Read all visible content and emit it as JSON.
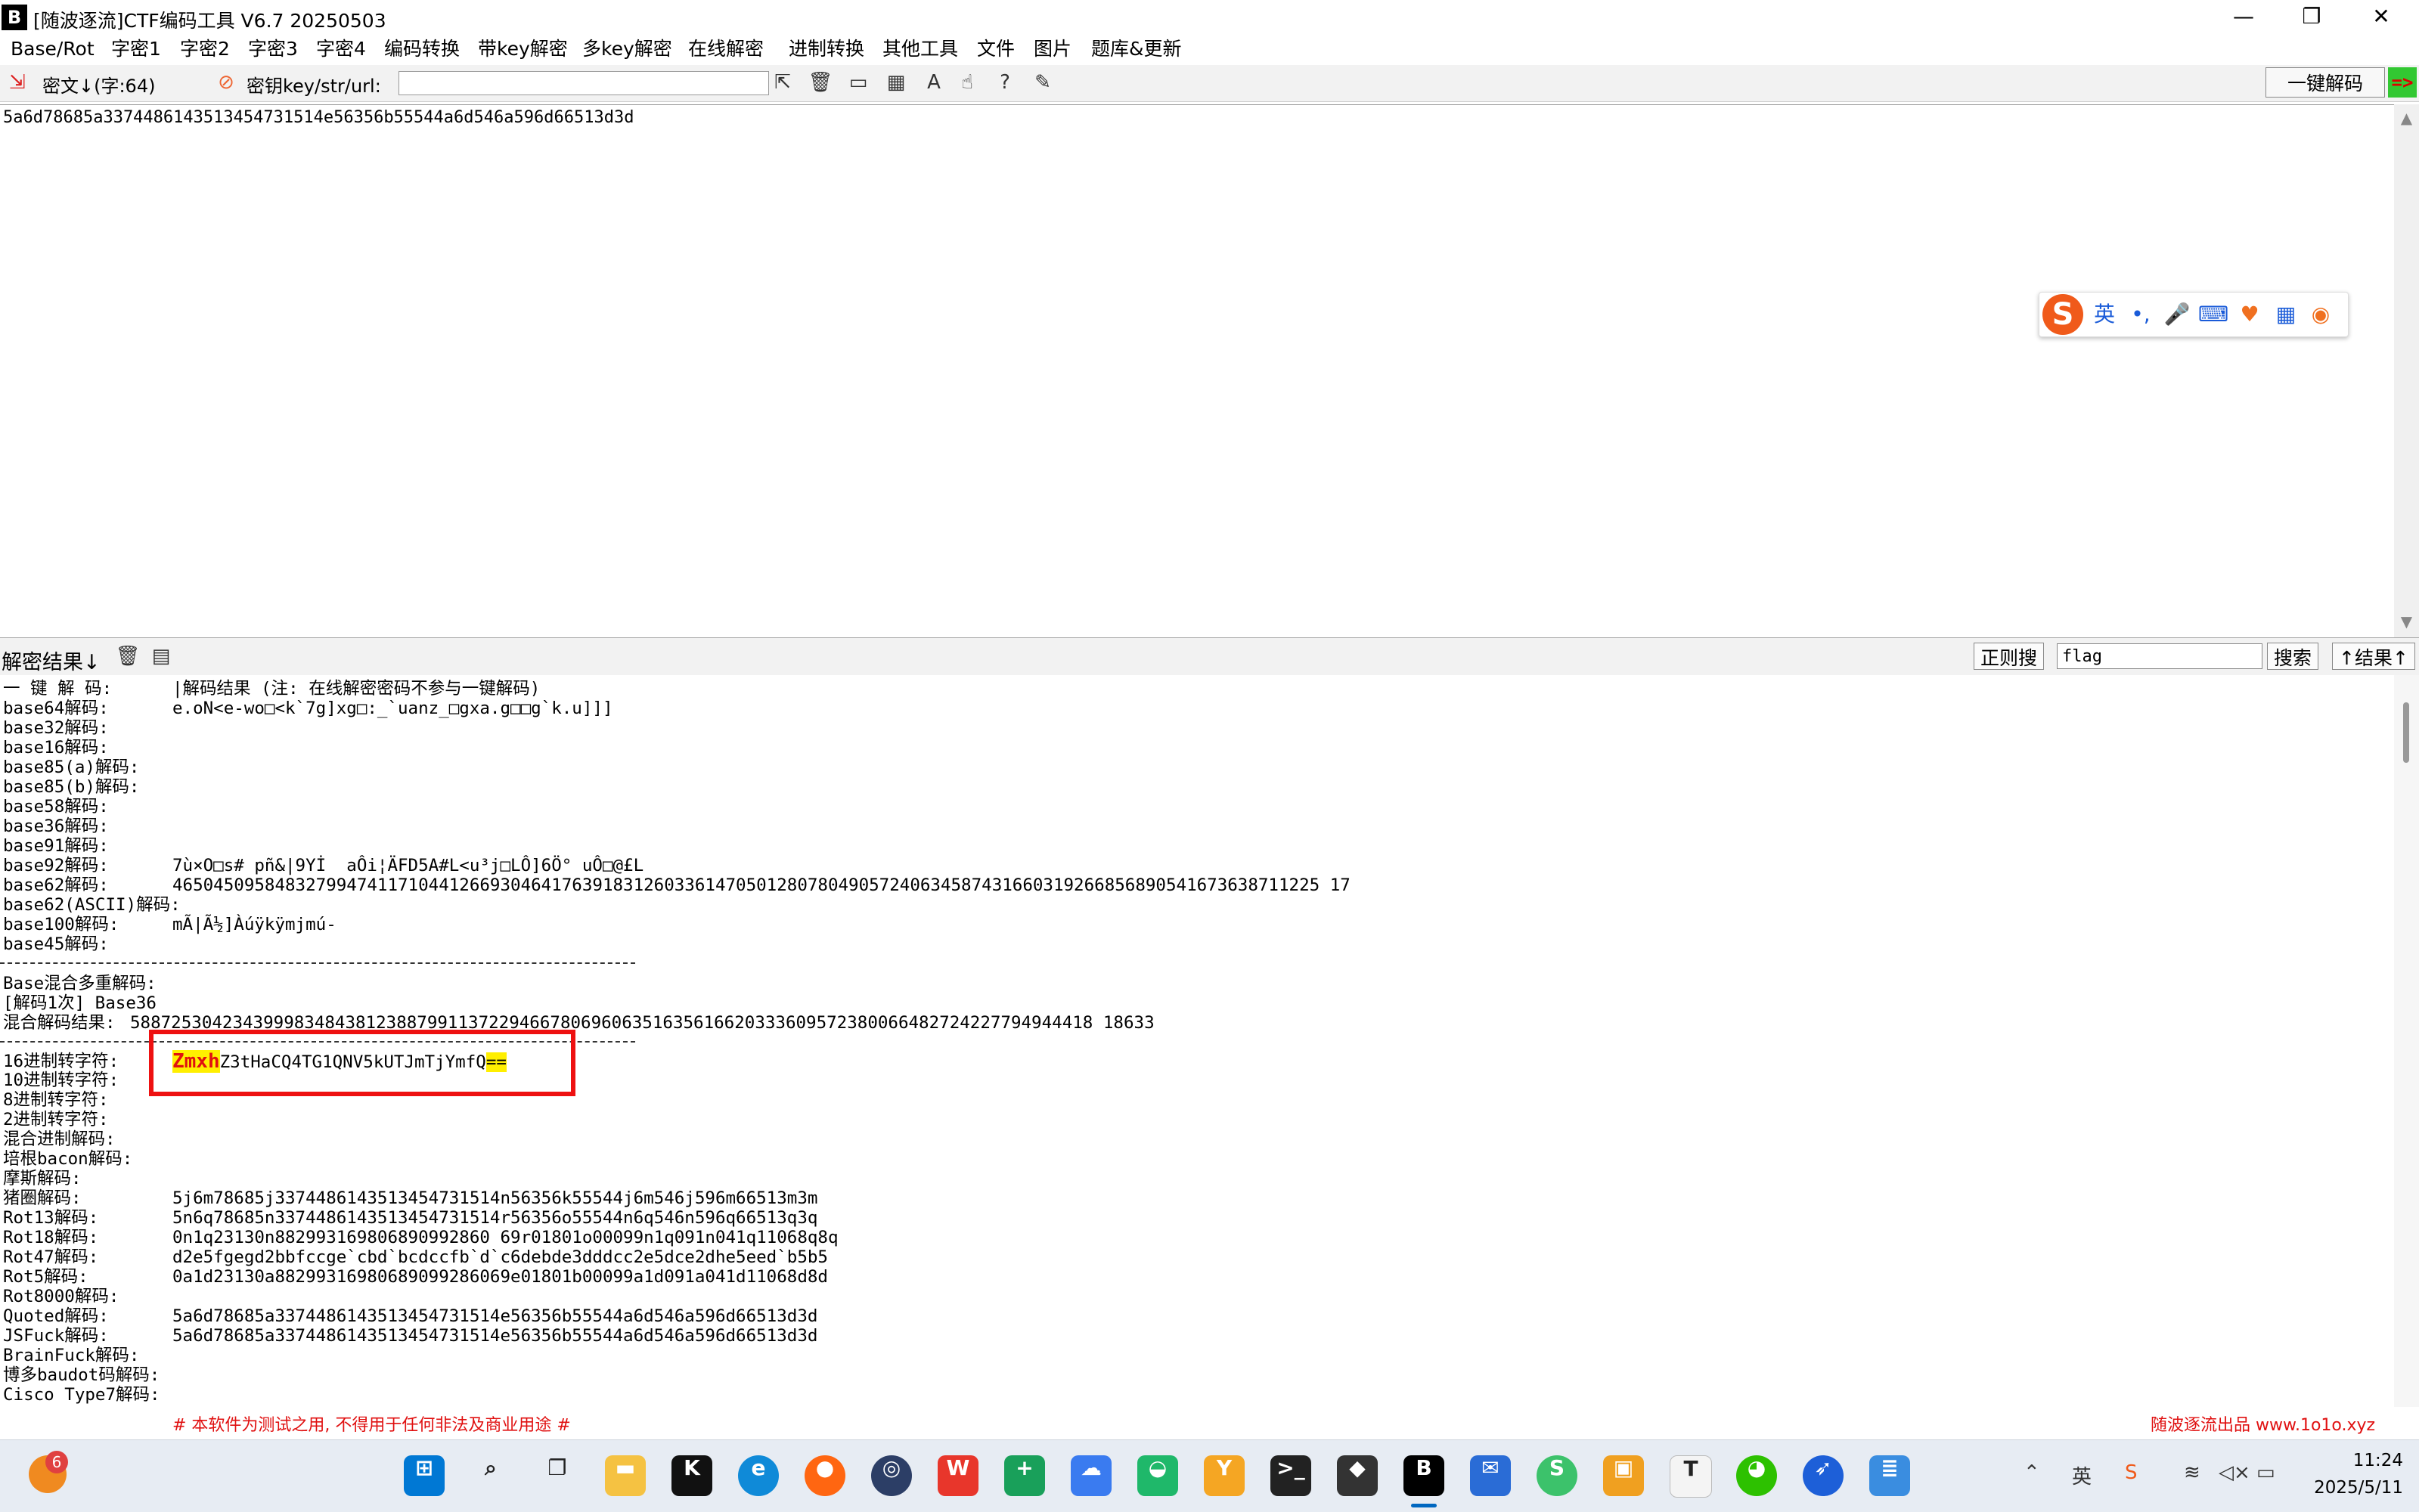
{
  "window": {
    "title": "[随波逐流]CTF编码工具 V6.7  20250503",
    "minimize": "—",
    "maximize": "❐",
    "close": "✕"
  },
  "menu": [
    "Base/Rot",
    "字密1",
    "字密2",
    "字密3",
    "字密4",
    "编码转换",
    "带key解密",
    "多key解密",
    "在线解密",
    "进制转换",
    "其他工具",
    "文件",
    "图片",
    "题库&更新"
  ],
  "toolbar": {
    "cipher_label": "密文↓(字:64)",
    "key_label": "密钥key/str/url:",
    "key_value": "",
    "one_click_label": "一键解码",
    "arrow_label": "=>"
  },
  "cipher_text": "5a6d78685a3374486143513454731514e56356b55544a6d546a596d66513d3d",
  "ime": {
    "lang": "英",
    "punct": "•,"
  },
  "result_bar": {
    "label": "解密结果↓",
    "regex_button": "正则搜",
    "search_value": "flag",
    "search_button": "搜索",
    "result_up_button": "↑结果↑"
  },
  "results": {
    "header_label": "一 键 解 码:",
    "header_value": "|解码结果 (注: 在线解密密码不参与一键解码)",
    "group1": [
      {
        "label": "base64解码:",
        "value": "e.oN<e-wo□<k`7g]xg□:_`uanz_□gxa.g□□g`k.u]]]"
      },
      {
        "label": "base32解码:",
        "value": ""
      },
      {
        "label": "base16解码:",
        "value": ""
      },
      {
        "label": "base85(a)解码:",
        "value": ""
      },
      {
        "label": "base85(b)解码:",
        "value": ""
      },
      {
        "label": "base58解码:",
        "value": ""
      },
      {
        "label": "base36解码:",
        "value": ""
      },
      {
        "label": "base91解码:",
        "value": ""
      },
      {
        "label": "base92解码:",
        "value": "7ù×O□s# pñ&|9Yİ  aÔi¦ÄFD5A#L<u³j□LÔ]6Ö° uÔ□@£L"
      },
      {
        "label": "base62解码:",
        "value": "4650450958483279947411710441266930464176391831260336147050128078049057240634587431660319266856890541673638711225 17"
      },
      {
        "label": "base62(ASCII)解码:",
        "value": ""
      },
      {
        "label": "base100解码:",
        "value": "mÃ|Ã½]Àúÿkÿmjmú-"
      },
      {
        "label": "base45解码:",
        "value": ""
      }
    ],
    "separator": "-----------------------------------------------------------------------",
    "mixed_title": "Base混合多重解码:",
    "mixed_round": "[解码1次] Base36",
    "mixed_result_label": "混合解码结果:",
    "mixed_result_value": "5887253042343999834843812388799113722946678069606351635616620333609572380066482724227794944418 18633",
    "hex": {
      "label": "16进制转字符:",
      "prefix": "Zmxh",
      "middle": "Z3tHaCQ4TG1QNV5kUTJmTjYmfQ",
      "suffix": "=="
    },
    "group2": [
      {
        "label": "10进制转字符:",
        "value": ""
      },
      {
        "label": "8进制转字符:",
        "value": ""
      },
      {
        "label": "2进制转字符:",
        "value": ""
      },
      {
        "label": "混合进制解码:",
        "value": ""
      },
      {
        "label": "培根bacon解码:",
        "value": ""
      },
      {
        "label": "摩斯解码:",
        "value": ""
      },
      {
        "label": "猪圈解码:",
        "value": "5j6m78685j3374486143513454731514n56356k55544j6m546j596m66513m3m"
      },
      {
        "label": "Rot13解码:",
        "value": "5n6q78685n3374486143513454731514r56356o55544n6q546n596q66513q3q"
      },
      {
        "label": "Rot18解码:",
        "value": "0n1q23130n882993169806890992860 69r01801o00099n1q091n041q11068q8q"
      },
      {
        "label": "Rot47解码:",
        "value": "d2e5fgegd2bbfccge`cbd`bcdccfb`d`c6debde3dddcc2e5dce2dhe5eed`b5b5"
      },
      {
        "label": "Rot5解码:",
        "value": "0a1d23130a88299316980689099286069e01801b00099a1d091a041d11068d8d"
      },
      {
        "label": "Rot8000解码:",
        "value": ""
      },
      {
        "label": "Quoted解码:",
        "value": "5a6d78685a3374486143513454731514e56356b55544a6d546a596d66513d3d"
      },
      {
        "label": "JSFuck解码:",
        "value": "5a6d78685a3374486143513454731514e56356b55544a6d546a596d66513d3d"
      },
      {
        "label": "BrainFuck解码:",
        "value": ""
      },
      {
        "label": "博多baudot码解码:",
        "value": ""
      },
      {
        "label": "Cisco Type7解码:",
        "value": ""
      }
    ]
  },
  "footer": {
    "notice": "# 本软件为测试之用, 不得用于任何非法及商业用途 #",
    "credit": "随波逐流出品 www.1o1o.xyz"
  },
  "taskbar": {
    "badge": "6",
    "tray_ime": "英",
    "time": "11:24",
    "date": "2025/5/11"
  },
  "colors": {
    "highlight_box": "#ee1111",
    "highlight_fill": "#ffef00",
    "footer_text": "#e01010",
    "accent": "#0067c0"
  }
}
